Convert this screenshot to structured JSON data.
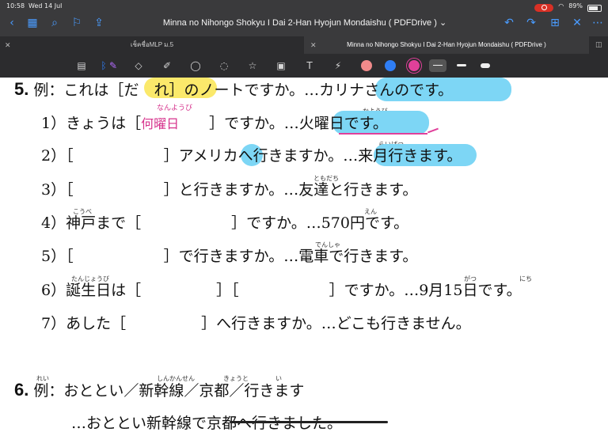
{
  "status": {
    "time": "10:58",
    "date": "Wed 14 Jul",
    "battery": "89%"
  },
  "nav": {
    "title": "Minna no Nihongo Shokyu I Dai 2-Han Hyojun Mondaishu ( PDFDrive )",
    "title_suffix": "⌄"
  },
  "tabs": [
    {
      "label": "เช็คชื่อMLP ม.5"
    },
    {
      "label": "Minna no Nihongo Shokyu I Dai 2-Han Hyojun Mondaishu ( PDFDrive )"
    }
  ],
  "colors": {
    "pink": "#f08a8a",
    "blue": "#2f7ef5",
    "magenta": "#e0409a",
    "highlight_blue": "#7dd6f5",
    "highlight_yellow": "#fbe96b"
  },
  "exercise5": {
    "number": "5.",
    "example": {
      "label": "例：",
      "text_a": "これは［",
      "blank": "だ　れ",
      "text_b": "］のノートですか。…",
      "answer": "カリナさんのです。"
    },
    "items": [
      {
        "n": "1）",
        "a": "きょうは［",
        "hand": "何曜日",
        "hand_ruby": "なんようび",
        "b": "　　］ですか。…",
        "answer": "火曜日です。",
        "answer_ruby": "かようび"
      },
      {
        "n": "2）",
        "a": "［　　　　　　］アメリカ",
        "he": "へ",
        "b": "行きますか。…",
        "answer": "来月行きます。",
        "answer_ruby": "らいげつ"
      },
      {
        "n": "3）",
        "a": "［　　　　　　］と行きますか。…友達と行きます。",
        "ruby": "ともだち"
      },
      {
        "n": "4）",
        "a": "神戸まで［　　　　　　］ですか。…570円です。",
        "ruby1": "こうべ",
        "ruby2": "えん"
      },
      {
        "n": "5）",
        "a": "［　　　　　　］で行きますか。…電車で行きます。",
        "ruby": "でんしゃ"
      },
      {
        "n": "6）",
        "a": "誕生日は［　　　　　］［　　　　　　］ですか。…9月15日です。",
        "ruby1": "たんじょうび",
        "ruby2": "がつ",
        "ruby3": "にち"
      },
      {
        "n": "7）",
        "a": "あした［　　　　　］へ行きますか。…どこも行きません。"
      }
    ]
  },
  "exercise6": {
    "number": "6.",
    "example": {
      "label": "例：",
      "text": "おととい／新幹線／京都／行きます",
      "ruby1": "しんかんせん",
      "ruby2": "きょうと",
      "ruby3": "い"
    },
    "answer_partial": "…おととい新幹線で京都へ行きました。"
  },
  "ruby_common": {
    "iki": "い",
    "rei": "れい"
  }
}
